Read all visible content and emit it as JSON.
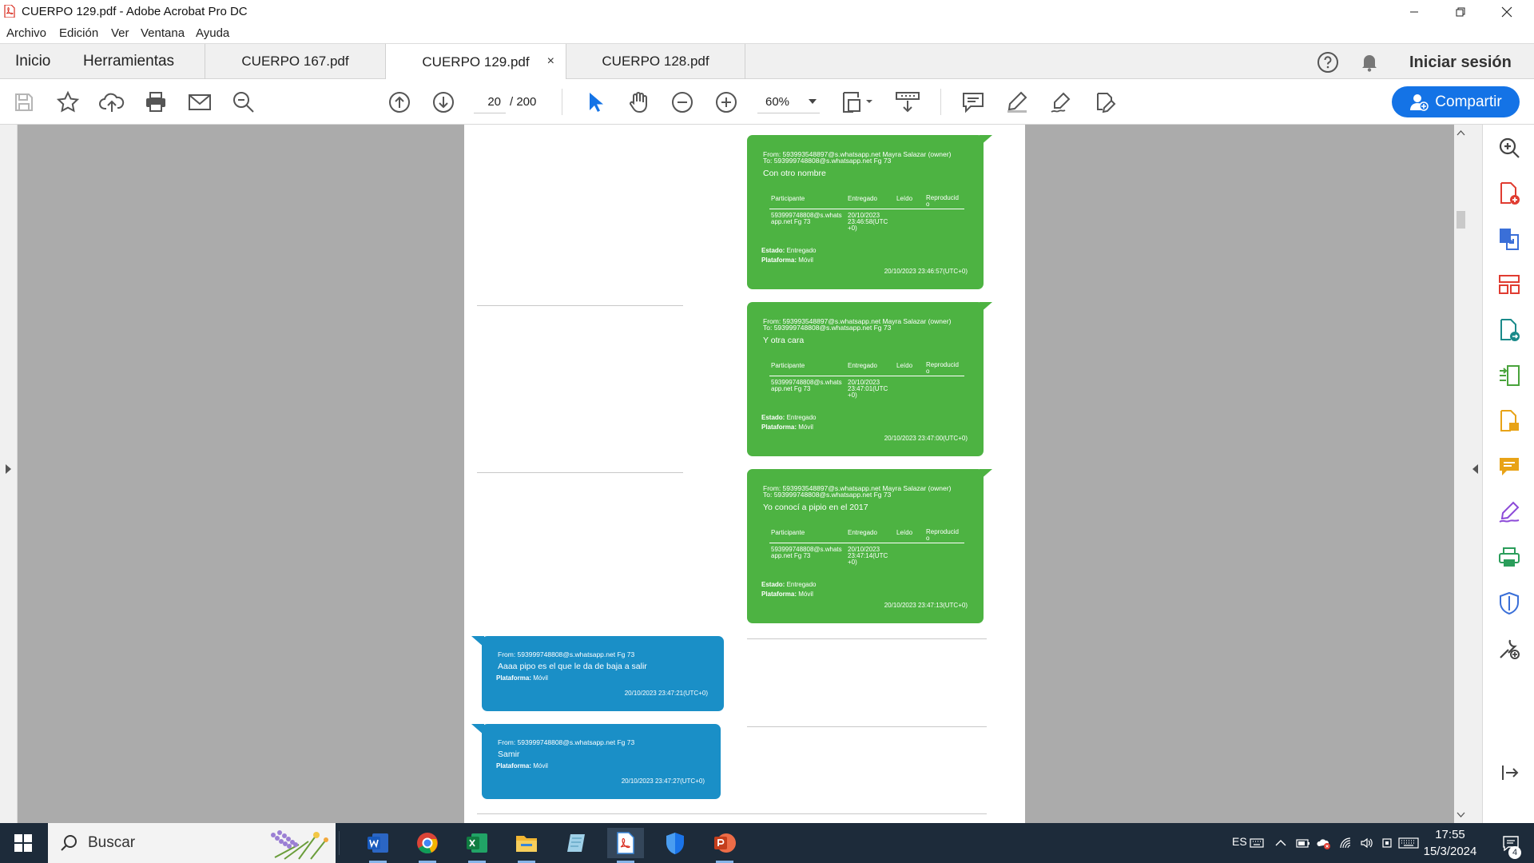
{
  "window": {
    "title": "CUERPO 129.pdf - Adobe Acrobat Pro DC"
  },
  "menu": [
    "Archivo",
    "Edición",
    "Ver",
    "Ventana",
    "Ayuda"
  ],
  "nav_tabs": [
    "Inicio",
    "Herramientas"
  ],
  "doc_tabs": [
    {
      "label": "CUERPO 167.pdf",
      "active": false
    },
    {
      "label": "CUERPO 129.pdf",
      "active": true
    },
    {
      "label": "CUERPO 128.pdf",
      "active": false
    }
  ],
  "tab_close": "×",
  "signin": "Iniciar sesión",
  "toolbar": {
    "page_current": "20",
    "page_total": "/ 200",
    "zoom": "60%",
    "share_label": "Compartir"
  },
  "messages": [
    {
      "from": "From: 593993548897@s.whatsapp.net Mayra Salazar (owner)",
      "to": "To: 593999748808@s.whatsapp.net Fg 73",
      "body": "Con otro nombre",
      "headers": [
        "Participante",
        "Entregado",
        "Leído",
        "Reproducid\no"
      ],
      "participant": "593999748808@s.whats\napp.net Fg 73",
      "delivered": "20/10/2023\n23:46:58(UTC\n+0)",
      "estado_label": "Estado:",
      "estado": "Entregado",
      "plataforma_label": "Plataforma:",
      "plataforma": "Móvil",
      "timestamp": "20/10/2023 23:46:57(UTC+0)"
    },
    {
      "from": "From: 593993548897@s.whatsapp.net Mayra Salazar (owner)",
      "to": "To: 593999748808@s.whatsapp.net Fg 73",
      "body": "Y otra cara",
      "headers": [
        "Participante",
        "Entregado",
        "Leído",
        "Reproducid\no"
      ],
      "participant": "593999748808@s.whats\napp.net Fg 73",
      "delivered": "20/10/2023\n23:47:01(UTC\n+0)",
      "estado_label": "Estado:",
      "estado": "Entregado",
      "plataforma_label": "Plataforma:",
      "plataforma": "Móvil",
      "timestamp": "20/10/2023 23:47:00(UTC+0)"
    },
    {
      "from": "From: 593993548897@s.whatsapp.net Mayra Salazar (owner)",
      "to": "To: 593999748808@s.whatsapp.net Fg 73",
      "body": "Yo conocí a pipio en el 2017",
      "headers": [
        "Participante",
        "Entregado",
        "Leído",
        "Reproducid\no"
      ],
      "participant": "593999748808@s.whats\napp.net Fg 73",
      "delivered": "20/10/2023\n23:47:14(UTC\n+0)",
      "estado_label": "Estado:",
      "estado": "Entregado",
      "plataforma_label": "Plataforma:",
      "plataforma": "Móvil",
      "timestamp": "20/10/2023 23:47:13(UTC+0)"
    },
    {
      "from": "From: 593999748808@s.whatsapp.net Fg 73",
      "body": "Aaaa pipo es el que le da de baja a salir",
      "plataforma_label": "Plataforma:",
      "plataforma": "Móvil",
      "timestamp": "20/10/2023 23:47:21(UTC+0)"
    },
    {
      "from": "From: 593999748808@s.whatsapp.net Fg 73",
      "body": "Samir",
      "plataforma_label": "Plataforma:",
      "plataforma": "Móvil",
      "timestamp": "20/10/2023 23:47:27(UTC+0)"
    }
  ],
  "taskbar": {
    "search_placeholder": "Buscar",
    "lang": "ES",
    "time": "17:55",
    "date": "15/3/2024",
    "notifications": "4"
  },
  "colors": {
    "bubble_green": "#4db342",
    "bubble_blue": "#1a8fc7",
    "accent": "#1473e6",
    "taskbar": "#1d2b3a"
  }
}
